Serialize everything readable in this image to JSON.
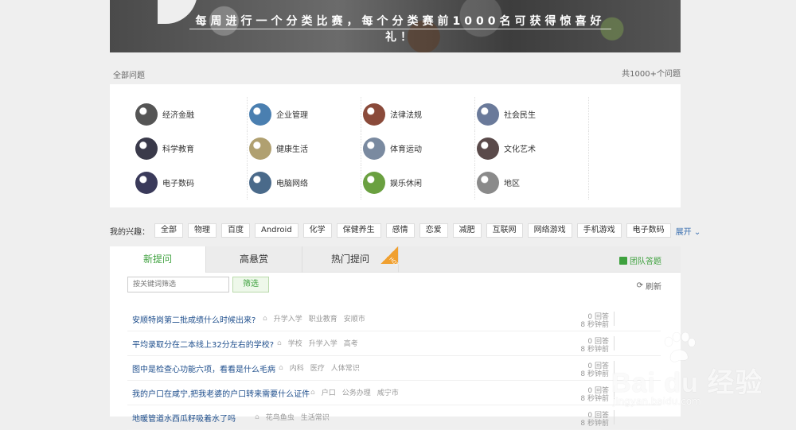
{
  "banner": {
    "slogan": "每周进行一个分类比赛，每个分类赛前1000名可获得惊喜好礼！"
  },
  "header": {
    "section_label": "全部问题",
    "count_label": "共1000+个问题"
  },
  "categories": [
    {
      "label": "经济金融",
      "icon": "finance-icon",
      "color": "#555"
    },
    {
      "label": "企业管理",
      "icon": "business-icon",
      "color": "#4a7fb0"
    },
    {
      "label": "法律法规",
      "icon": "law-icon",
      "color": "#8a4a3a"
    },
    {
      "label": "社会民生",
      "icon": "society-icon",
      "color": "#6a7a9a"
    },
    {
      "label": "科学教育",
      "icon": "science-icon",
      "color": "#3a3a4a"
    },
    {
      "label": "健康生活",
      "icon": "health-icon",
      "color": "#b0a070"
    },
    {
      "label": "体育运动",
      "icon": "sports-icon",
      "color": "#7a8aa0"
    },
    {
      "label": "文化艺术",
      "icon": "culture-icon",
      "color": "#5a4a4a"
    },
    {
      "label": "电子数码",
      "icon": "electronics-icon",
      "color": "#3a3a5a"
    },
    {
      "label": "电脑网络",
      "icon": "network-icon",
      "color": "#4a6a8a"
    },
    {
      "label": "娱乐休闲",
      "icon": "entertainment-icon",
      "color": "#6aa040"
    },
    {
      "label": "地区",
      "icon": "region-icon",
      "color": "#8a8a8a"
    }
  ],
  "interests": {
    "title": "我的兴趣：",
    "tags": [
      "全部",
      "物理",
      "百度",
      "Android",
      "化学",
      "保健养生",
      "感情",
      "恋爱",
      "减肥",
      "互联网",
      "网络游戏",
      "手机游戏",
      "电子数码"
    ],
    "expand_label": "展开"
  },
  "tabs": [
    {
      "label": "新提问",
      "active": true
    },
    {
      "label": "高悬赏",
      "active": false
    },
    {
      "label": "热门提问",
      "active": false,
      "badge": "HOT"
    }
  ],
  "team_answer_label": "团队答题",
  "filter": {
    "placeholder": "按关键词筛选",
    "button_label": "筛选",
    "refresh_label": "刷新"
  },
  "questions": [
    {
      "title": "安顺特岗第二批成绩什么时候出来?",
      "tags": [
        "升学入学",
        "职业教育",
        "安顺市"
      ],
      "answers": "0 回答",
      "time": "8 秒钟前"
    },
    {
      "title": "平均录取分在二本线上32分左右的学校?",
      "tags": [
        "学校",
        "升学入学",
        "高考"
      ],
      "answers": "0 回答",
      "time": "8 秒钟前"
    },
    {
      "title": "图中是检查心功能六项，看看是什么毛病",
      "tags": [
        "内科",
        "医疗",
        "人体常识"
      ],
      "answers": "0 回答",
      "time": "8 秒钟前"
    },
    {
      "title": "我的户口在咸宁,把我老婆的户口转来需要什么证件",
      "tags": [
        "户口",
        "公务办理",
        "咸宁市"
      ],
      "answers": "0 回答",
      "time": "8 秒钟前"
    },
    {
      "title": "地暖管道水西瓜籽吸着水了吗",
      "tags": [
        "花鸟鱼虫",
        "生活常识"
      ],
      "answers": "0 回答",
      "time": "8 秒钟前"
    }
  ],
  "watermark": {
    "text": "Bai du 经验",
    "url": "jingyan.baidu.com"
  }
}
